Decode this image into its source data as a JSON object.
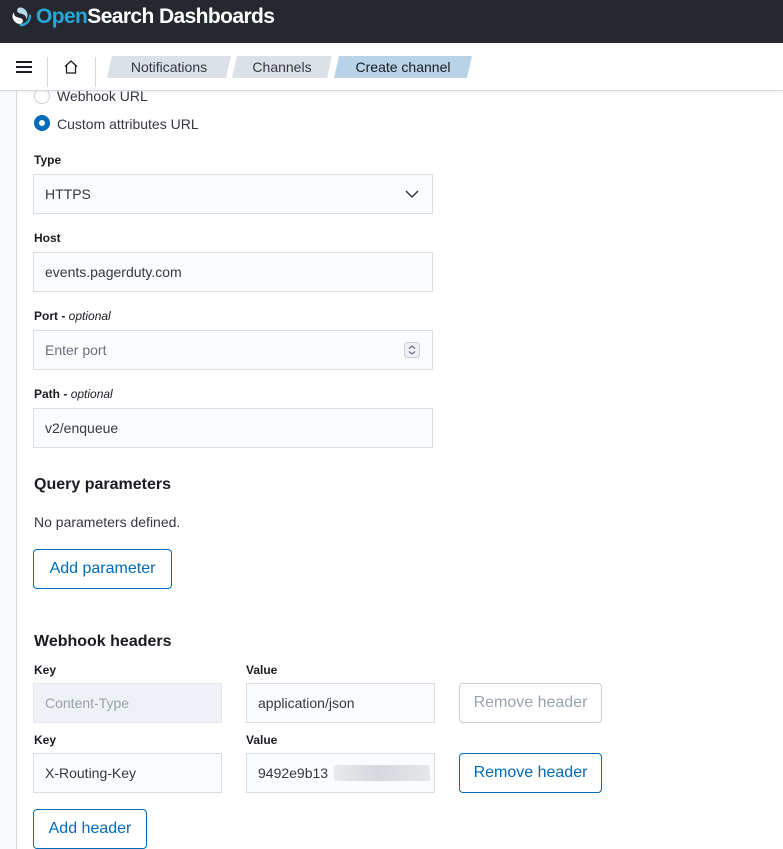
{
  "header": {
    "brand_prefix": "Open",
    "brand_suffix": "Search Dashboards"
  },
  "breadcrumbs": [
    "Notifications",
    "Channels",
    "Create channel"
  ],
  "radios": {
    "webhook_url": "Webhook URL",
    "custom_attributes_url": "Custom attributes URL",
    "selected": "custom_attributes_url"
  },
  "type_field": {
    "label": "Type",
    "value": "HTTPS"
  },
  "host_field": {
    "label": "Host",
    "value": "events.pagerduty.com"
  },
  "port_field": {
    "label": "Port",
    "optional": "optional",
    "placeholder": "Enter port"
  },
  "path_field": {
    "label": "Path",
    "optional": "optional",
    "value": "v2/enqueue"
  },
  "query": {
    "title": "Query parameters",
    "empty": "No parameters defined.",
    "add_button": "Add parameter"
  },
  "headers": {
    "title": "Webhook headers",
    "key_label": "Key",
    "value_label": "Value",
    "rows": [
      {
        "key": "Content-Type",
        "value": "application/json",
        "remove": "Remove header",
        "disabled": true
      },
      {
        "key": "X-Routing-Key",
        "value": "9492e9b13",
        "remove": "Remove header",
        "disabled": false
      }
    ],
    "add_button": "Add header"
  },
  "colors": {
    "accent": "#006bb8",
    "topbar": "#25282f",
    "brand": "#26a7d8"
  }
}
